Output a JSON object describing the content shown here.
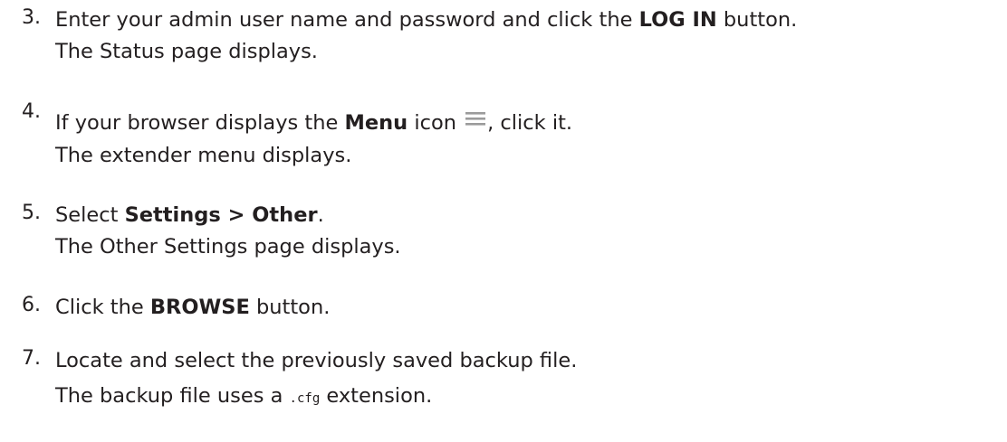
{
  "steps": [
    {
      "number": "3.",
      "line1": {
        "pre": "Enter your admin user name and password and click the ",
        "bold": "LOG IN",
        "post": " button."
      },
      "line2": "The Status page displays."
    },
    {
      "number": "4.",
      "line1": {
        "pre": "If your browser displays the ",
        "bold": "Menu",
        "mid": " icon ",
        "icon": "menu-icon",
        "post": ", click it."
      },
      "line2": "The extender menu displays."
    },
    {
      "number": "5.",
      "line1": {
        "pre": "Select ",
        "bold": "Settings > Other",
        "post": "."
      },
      "line2": "The Other Settings page displays."
    },
    {
      "number": "6.",
      "line1": {
        "pre": "Click the ",
        "bold": "BROWSE",
        "post": " button."
      }
    },
    {
      "number": "7.",
      "line1": {
        "text": "Locate and select the previously saved backup file."
      },
      "line2": {
        "pre": "The backup file uses a ",
        "code": ".cfg",
        "post": " extension."
      }
    }
  ],
  "colors": {
    "text": "#231f20",
    "icon": "#9b9b9b"
  }
}
